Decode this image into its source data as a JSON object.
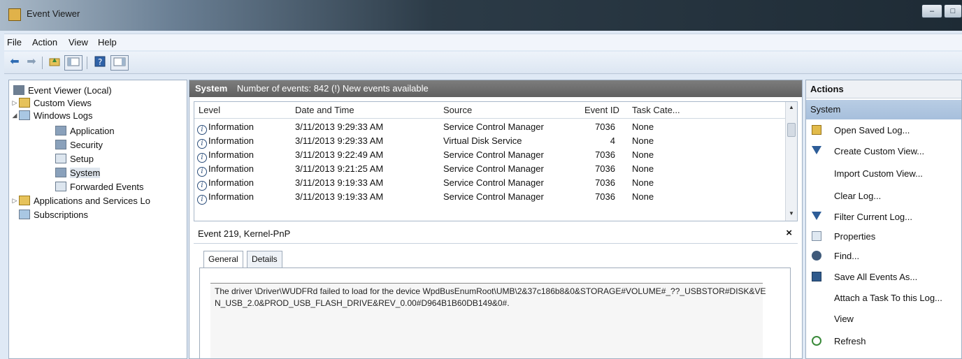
{
  "window": {
    "title": "Event Viewer",
    "minimize_label": "–",
    "maximize_label": "□"
  },
  "menu": {
    "items": [
      "File",
      "Action",
      "View",
      "Help"
    ]
  },
  "toolbar": {
    "back_glyph": "⬅",
    "forward_glyph": "➡"
  },
  "tree": {
    "root": "Event Viewer (Local)",
    "custom_views": "Custom Views",
    "windows_logs": "Windows Logs",
    "application": "Application",
    "security": "Security",
    "setup": "Setup",
    "system": "System",
    "forwarded_events": "Forwarded Events",
    "apps_services": "Applications and Services Lo",
    "subscriptions": "Subscriptions"
  },
  "log_header": {
    "name": "System",
    "status": "Number of events: 842 (!) New events available"
  },
  "grid": {
    "columns": [
      "Level",
      "Date and Time",
      "Source",
      "Event ID",
      "Task Cate..."
    ],
    "rows": [
      {
        "level": "Information",
        "datetime": "3/11/2013 9:29:33 AM",
        "source": "Service Control Manager",
        "event_id": "7036",
        "task": "None"
      },
      {
        "level": "Information",
        "datetime": "3/11/2013 9:29:33 AM",
        "source": "Virtual Disk Service",
        "event_id": "4",
        "task": "None"
      },
      {
        "level": "Information",
        "datetime": "3/11/2013 9:22:49 AM",
        "source": "Service Control Manager",
        "event_id": "7036",
        "task": "None"
      },
      {
        "level": "Information",
        "datetime": "3/11/2013 9:21:25 AM",
        "source": "Service Control Manager",
        "event_id": "7036",
        "task": "None"
      },
      {
        "level": "Information",
        "datetime": "3/11/2013 9:19:33 AM",
        "source": "Service Control Manager",
        "event_id": "7036",
        "task": "None"
      },
      {
        "level": "Information",
        "datetime": "3/11/2013 9:19:33 AM",
        "source": "Service Control Manager",
        "event_id": "7036",
        "task": "None"
      }
    ]
  },
  "detail": {
    "title": "Event 219, Kernel-PnP",
    "close_label": "×",
    "tabs": [
      "General",
      "Details"
    ],
    "description": "The driver \\Driver\\WUDFRd failed to load for the device WpdBusEnumRoot\\UMB\\2&37c186b8&0&STORAGE#VOLUME#_??_USBSTOR#DISK&VEN_USB_2.0&PROD_USB_FLASH_DRIVE&REV_0.00#D964B1B60DB149&0#."
  },
  "actions": {
    "header": "Actions",
    "section": "System",
    "items": [
      "Open Saved Log...",
      "Create Custom View...",
      "Import Custom View...",
      "Clear Log...",
      "Filter Current Log...",
      "Properties",
      "Find...",
      "Save All Events As...",
      "Attach a Task To this Log...",
      "View",
      "Refresh"
    ]
  }
}
